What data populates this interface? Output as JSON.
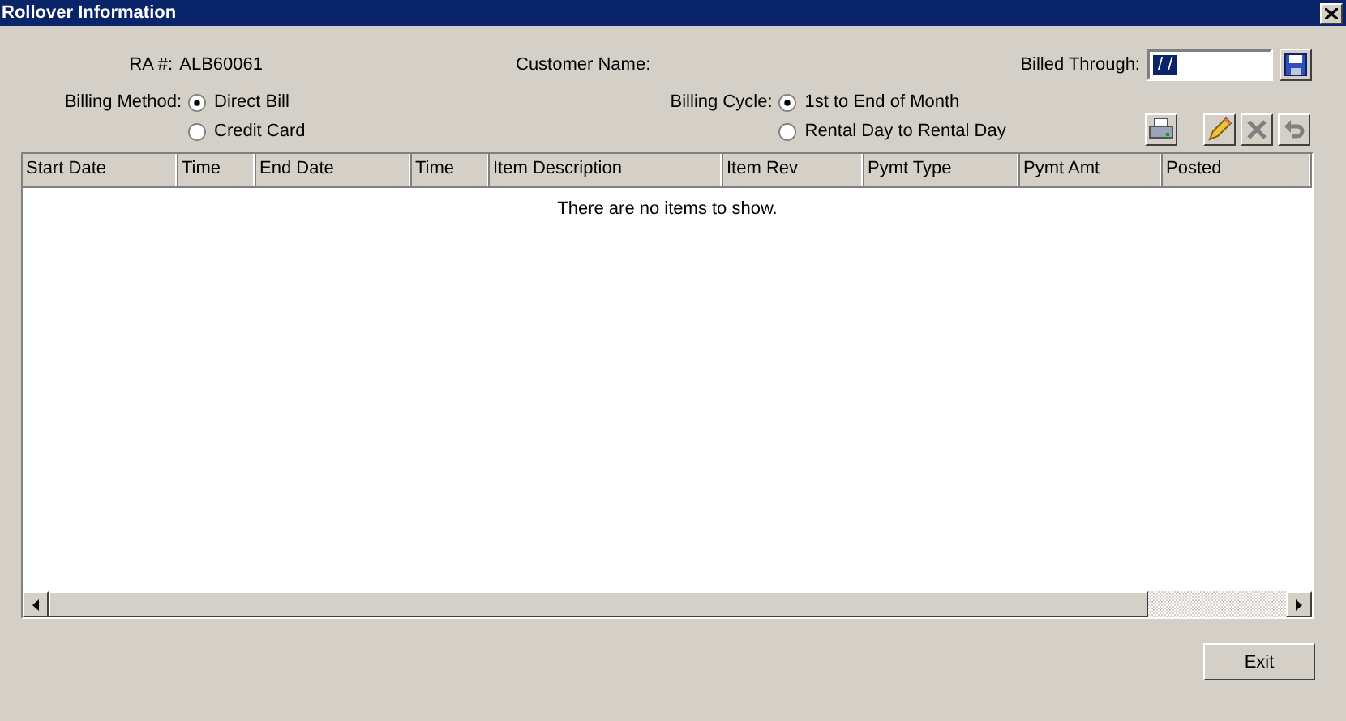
{
  "window": {
    "title": "Rollover Information"
  },
  "ra": {
    "label": "RA #:",
    "value": "ALB60061"
  },
  "customer_name": {
    "label": "Customer Name:"
  },
  "billed_through": {
    "label": "Billed Through:",
    "value": "/ /"
  },
  "billing_method": {
    "label": "Billing Method:",
    "options": [
      {
        "label": "Direct Bill",
        "selected": true
      },
      {
        "label": "Credit Card",
        "selected": false
      }
    ]
  },
  "billing_cycle": {
    "label": "Billing Cycle:",
    "options": [
      {
        "label": "1st to End of Month",
        "selected": true
      },
      {
        "label": "Rental Day to Rental Day",
        "selected": false
      }
    ]
  },
  "toolbar": [
    {
      "kind": "print",
      "disabled": false
    },
    {
      "kind": "edit",
      "disabled": false
    },
    {
      "kind": "delete",
      "disabled": true
    },
    {
      "kind": "undo",
      "disabled": true
    }
  ],
  "table": {
    "columns": [
      "Start Date",
      "Time",
      "End Date",
      "Time",
      "Item Description",
      "Item Rev",
      "Pymt Type",
      "Pymt Amt",
      "Posted"
    ],
    "empty_message": "There are no items to show."
  },
  "buttons": [
    "Exit"
  ]
}
